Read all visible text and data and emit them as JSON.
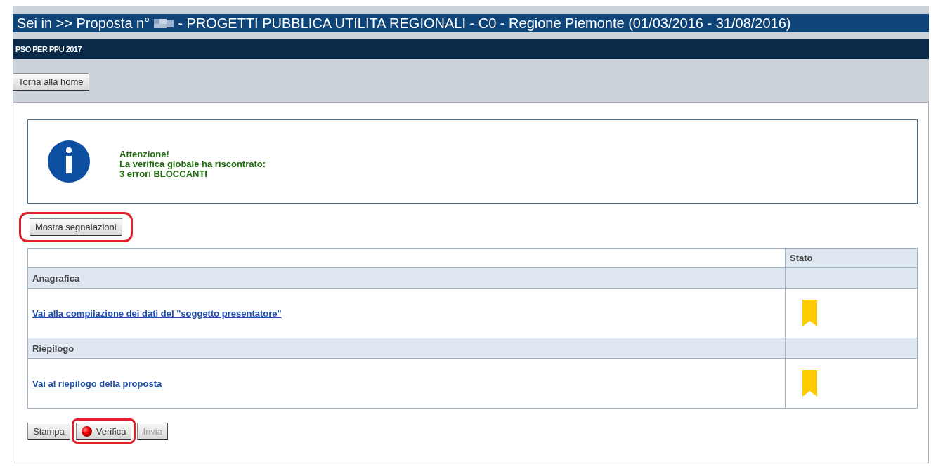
{
  "breadcrumb": {
    "prefix": "Sei in >> Proposta n°",
    "redacted": true,
    "title": "- PROGETTI PUBBLICA UTILITA REGIONALI - C0 - Regione Piemonte (01/03/2016 - 31/08/2016)"
  },
  "subtitle": "PSO PER PPU 2017",
  "home_button": "Torna alla home",
  "notice": {
    "lines": [
      "Attenzione!",
      "La verifica globale ha riscontrato:",
      "3 errori BLOCCANTI"
    ]
  },
  "show_button": {
    "label": "Mostra segnalazioni",
    "highlighted": true
  },
  "table": {
    "columns": [
      "",
      "Stato"
    ],
    "rows": [
      {
        "kind": "section",
        "label": "Anagrafica"
      },
      {
        "kind": "link",
        "label": "Vai alla compilazione dei dati del \"soggetto presentatore\"",
        "color": "#ffcc00"
      },
      {
        "kind": "section",
        "label": "Riepilogo"
      },
      {
        "kind": "link",
        "label": "Vai al riepilogo della proposta",
        "color": "#ffcc00"
      }
    ]
  },
  "actions": [
    {
      "label": "Stampa",
      "highlighted": false,
      "disabled": false,
      "dot": false
    },
    {
      "label": "Verifica",
      "highlighted": true,
      "disabled": false,
      "dot": true
    },
    {
      "label": "Invia",
      "highlighted": false,
      "disabled": true,
      "dot": false
    }
  ]
}
